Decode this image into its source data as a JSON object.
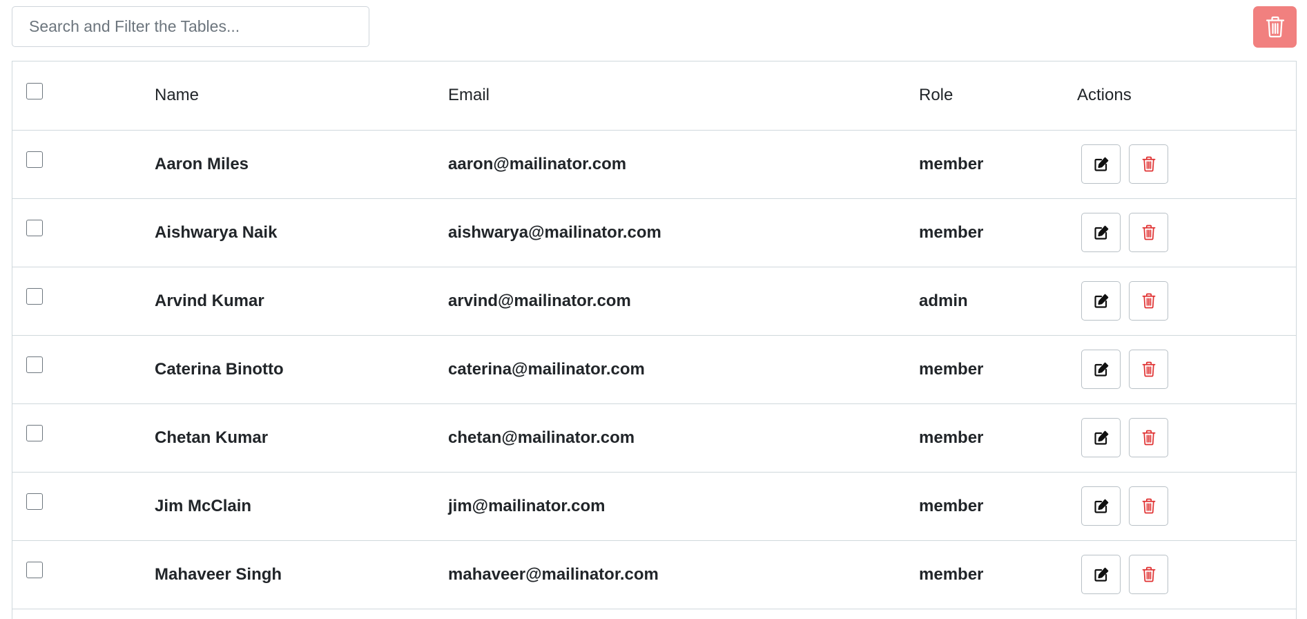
{
  "search": {
    "placeholder": "Search and Filter the Tables...",
    "value": ""
  },
  "colors": {
    "bulk_delete_bg": "#f1807f",
    "delete_icon": "#e03131",
    "border": "#cfd8dc"
  },
  "table": {
    "headers": {
      "name": "Name",
      "email": "Email",
      "role": "Role",
      "actions": "Actions"
    },
    "rows": [
      {
        "name": "Aaron Miles",
        "email": "aaron@mailinator.com",
        "role": "member"
      },
      {
        "name": "Aishwarya Naik",
        "email": "aishwarya@mailinator.com",
        "role": "member"
      },
      {
        "name": "Arvind Kumar",
        "email": "arvind@mailinator.com",
        "role": "admin"
      },
      {
        "name": "Caterina Binotto",
        "email": "caterina@mailinator.com",
        "role": "member"
      },
      {
        "name": "Chetan Kumar",
        "email": "chetan@mailinator.com",
        "role": "member"
      },
      {
        "name": "Jim McClain",
        "email": "jim@mailinator.com",
        "role": "member"
      },
      {
        "name": "Mahaveer Singh",
        "email": "mahaveer@mailinator.com",
        "role": "member"
      }
    ]
  },
  "icons": {
    "bulk_delete": "trash-icon",
    "edit": "edit-icon",
    "delete": "trash-icon"
  }
}
